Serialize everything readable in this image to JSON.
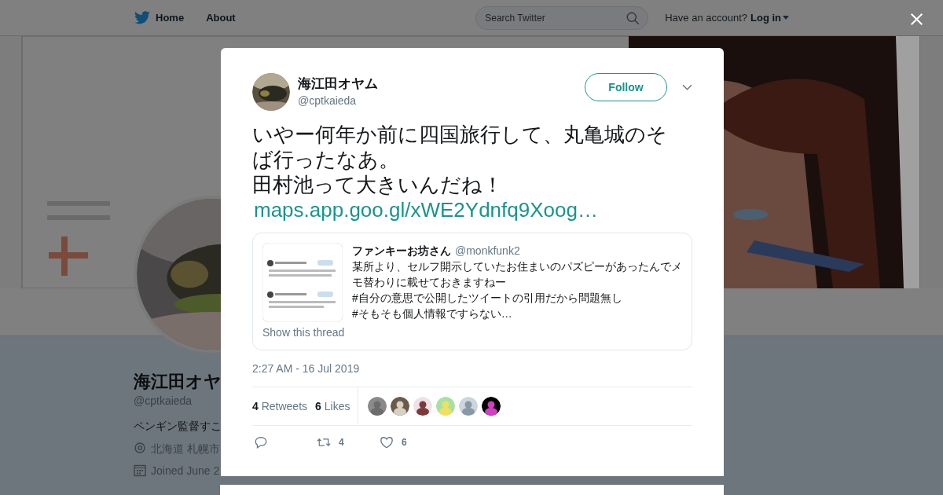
{
  "nav": {
    "links": [
      "Home",
      "About"
    ],
    "search": {
      "placeholder": "Search Twitter"
    },
    "account_prompt": "Have an account?",
    "login": "Log in"
  },
  "profile": {
    "name": "海江田オヤ",
    "handle": "@cptkaieda",
    "bio": "ペンギン監督すこ",
    "location": "北海道 札幌市",
    "joined": "Joined June 2"
  },
  "tweet": {
    "author": {
      "name": "海江田オヤム",
      "handle": "@cptkaieda"
    },
    "follow_label": "Follow",
    "text_lines": [
      "いやー何年か前に四国旅行して、丸亀城のそば行ったなあ。",
      "田村池って大きいんだね！"
    ],
    "link": "maps.app.goo.gl/xWE2Ydnfq9Xoog…",
    "quote": {
      "name": "ファンキーお坊さん",
      "handle": "@monkfunk2",
      "text_lines": [
        "某所より、セルフ開示していたお住まいのパズピーがあったんでメモ替わりに載せておきますねー",
        "#自分の意思で公開したツイートの引用だから問題無し",
        "#そもそも個人情報ですらない…"
      ],
      "thread_link": "Show this thread"
    },
    "timestamp": "2:27 AM - 16 Jul 2019",
    "retweets": {
      "count": "4",
      "label": "Retweets"
    },
    "likes": {
      "count": "6",
      "label": "Likes"
    },
    "likers": [
      {
        "kind": "picture"
      },
      {
        "kind": "picture"
      },
      {
        "kind": "picture"
      },
      {
        "kind": "picture"
      },
      {
        "kind": "picture"
      },
      {
        "kind": "picture"
      }
    ],
    "actions": [
      {
        "kind": "reply"
      },
      {
        "kind": "retweet",
        "count": "4"
      },
      {
        "kind": "like",
        "count": "6"
      }
    ]
  }
}
